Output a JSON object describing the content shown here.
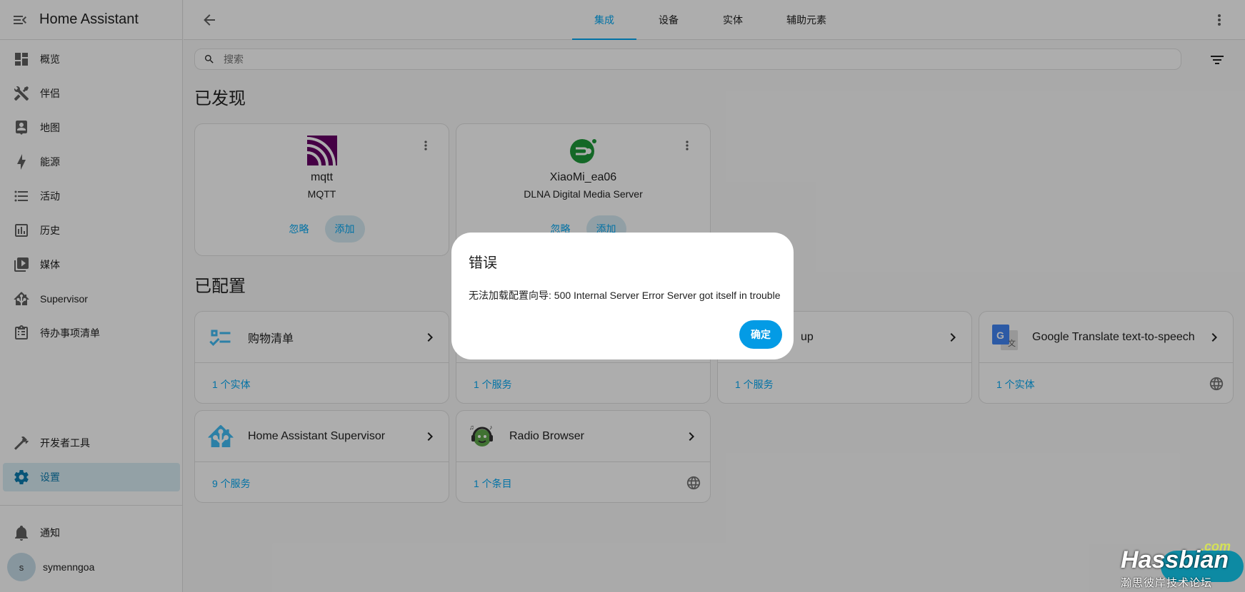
{
  "app": {
    "title": "Home Assistant"
  },
  "sidebar": {
    "items": [
      {
        "label": "概览",
        "icon": "dashboard-icon"
      },
      {
        "label": "伴侣",
        "icon": "tools-icon"
      },
      {
        "label": "地图",
        "icon": "map-account-icon"
      },
      {
        "label": "能源",
        "icon": "lightning-icon"
      },
      {
        "label": "活动",
        "icon": "list-icon"
      },
      {
        "label": "历史",
        "icon": "chart-box-icon"
      },
      {
        "label": "媒体",
        "icon": "play-box-icon"
      },
      {
        "label": "Supervisor",
        "icon": "home-assistant-icon"
      },
      {
        "label": "待办事项清单",
        "icon": "clipboard-list-icon"
      }
    ],
    "bottom_items": [
      {
        "label": "开发者工具",
        "icon": "hammer-icon"
      },
      {
        "label": "设置",
        "icon": "cog-icon",
        "active": true
      }
    ],
    "notifications_label": "通知",
    "user": {
      "initial": "s",
      "name": "symenngoa"
    }
  },
  "header": {
    "tabs": [
      {
        "label": "集成",
        "active": true
      },
      {
        "label": "设备"
      },
      {
        "label": "实体"
      },
      {
        "label": "辅助元素"
      }
    ]
  },
  "search": {
    "placeholder": "搜索"
  },
  "discovered": {
    "title": "已发现",
    "cards": [
      {
        "name": "mqtt",
        "subtitle": "MQTT",
        "ignore_label": "忽略",
        "add_label": "添加"
      },
      {
        "name": "XiaoMi_ea06",
        "subtitle": "DLNA Digital Media Server",
        "ignore_label": "忽略",
        "add_label": "添加"
      }
    ]
  },
  "configured": {
    "title": "已配置",
    "cards": [
      {
        "name": "购物清单",
        "footer": "1 个实体"
      },
      {
        "name": "",
        "footer": "1 个服务"
      },
      {
        "name": "up",
        "footer": "1 个服务"
      },
      {
        "name": "Google Translate text-to-speech",
        "footer": "1 个实体"
      },
      {
        "name": "Home Assistant Supervisor",
        "footer": "9 个服务"
      },
      {
        "name": "Radio Browser",
        "footer": "1 个条目"
      }
    ]
  },
  "dialog": {
    "title": "错误",
    "message": "无法加载配置向导: 500 Internal Server Error Server got itself in trouble",
    "confirm_label": "确定"
  },
  "watermark": {
    "com": ".com",
    "name": "Hassbian",
    "sub": "瀚思彼岸技术论坛"
  },
  "colors": {
    "primary": "#03a9f4",
    "mqtt_purple": "#660066",
    "dlna_green": "#1e9a3a",
    "ha_blue": "#41bdf5"
  }
}
